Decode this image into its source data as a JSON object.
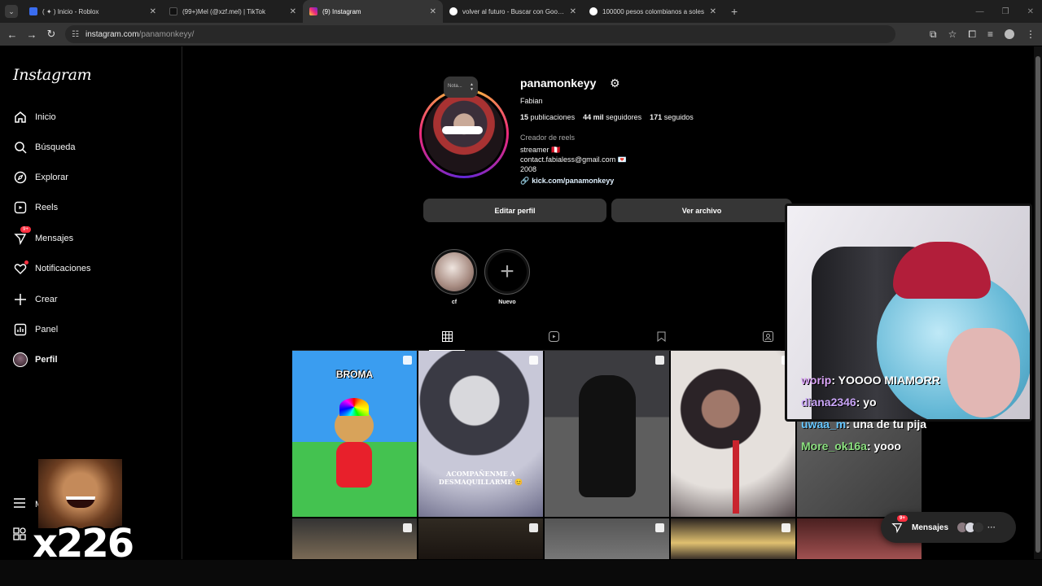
{
  "browser": {
    "tabs": [
      {
        "title": "( ✦ ) Inicio - Roblox",
        "fav_color": "#3a6df0"
      },
      {
        "title": "(99+)Mel (@xzf.mel) | TikTok",
        "fav_color": "#111111"
      },
      {
        "title": "(9) Instagram",
        "fav_color": "#e1306c"
      },
      {
        "title": "volver al futuro - Buscar con Google",
        "fav_color": "#ffffff"
      },
      {
        "title": "100000 pesos colombianos a soles",
        "fav_color": "#ffffff"
      }
    ],
    "url_host": "instagram.com",
    "url_path": "/panamonkeyy/"
  },
  "sidebar": {
    "logo": "Instagram",
    "items": [
      {
        "label": "Inicio",
        "icon": "home-icon"
      },
      {
        "label": "Búsqueda",
        "icon": "search-icon"
      },
      {
        "label": "Explorar",
        "icon": "compass-icon"
      },
      {
        "label": "Reels",
        "icon": "reels-icon"
      },
      {
        "label": "Mensajes",
        "icon": "messenger-icon",
        "badge": "9+"
      },
      {
        "label": "Notificaciones",
        "icon": "heart-icon"
      },
      {
        "label": "Crear",
        "icon": "plus-icon"
      },
      {
        "label": "Panel",
        "icon": "chart-icon"
      },
      {
        "label": "Perfil",
        "icon": "avatar"
      }
    ],
    "more_label": "M"
  },
  "profile": {
    "note": "Nota...",
    "username": "panamonkeyy",
    "full_name": "Fabian",
    "posts_count": "15",
    "posts_label": "publicaciones",
    "followers_count": "44 mil",
    "followers_label": "seguidores",
    "following_count": "171",
    "following_label": "seguidos",
    "category": "Creador de reels",
    "bio_line1": "streamer 🇵🇪",
    "bio_line2": "contact.fabialess@gmail.com 💌",
    "bio_line3": "2008",
    "link": "kick.com/panamonkeyy",
    "edit_button": "Editar perfil",
    "archive_button": "Ver archivo"
  },
  "highlights": [
    {
      "label": "cf"
    },
    {
      "label": "Nuevo"
    }
  ],
  "posts": {
    "p1_caption": "BROMA",
    "p2_caption": "ACOMPAÑENME A DESMAQUILLARME 😊"
  },
  "chat": [
    {
      "user": "worip",
      "msg": ": YOOOO MIAMORR"
    },
    {
      "user": "diana2346",
      "msg": ": yo"
    },
    {
      "user": "uwaa_m",
      "msg": ": una de tu pija"
    },
    {
      "user": "More_ok16a",
      "msg": ": yooo"
    }
  ],
  "overlay": {
    "counter": "x226"
  },
  "messages_pill": {
    "label": "Mensajes",
    "badge": "9+"
  }
}
